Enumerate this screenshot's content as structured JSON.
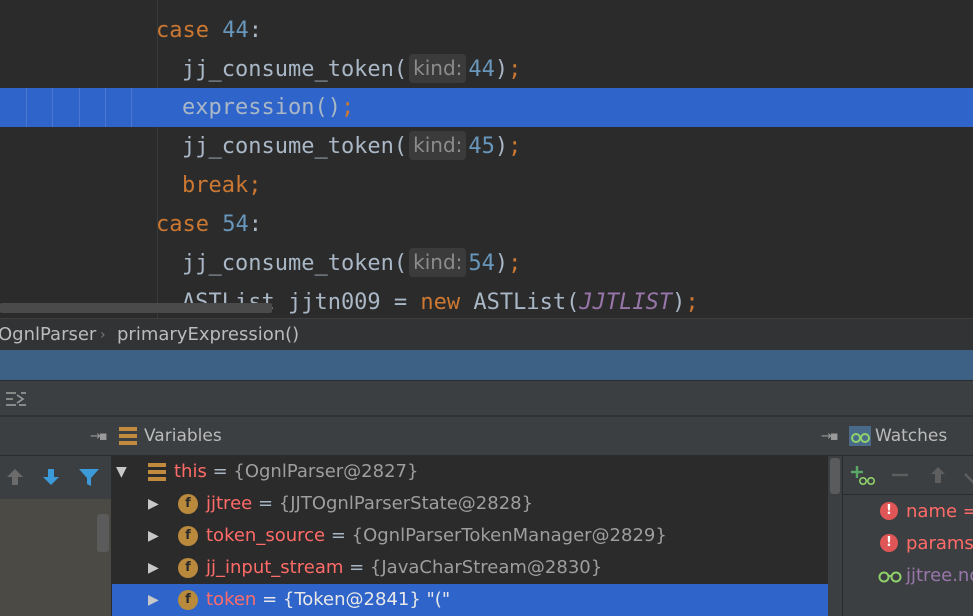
{
  "editor": {
    "lines": [
      {
        "indent": "case",
        "parts": [
          {
            "t": "case ",
            "c": "kw"
          },
          {
            "t": "44",
            "c": "num"
          },
          {
            "t": ":",
            "c": "id"
          }
        ]
      },
      {
        "indent": "body",
        "parts": [
          {
            "t": "jj_consume_token(",
            "c": "id"
          },
          {
            "t": "kind:",
            "c": "hint"
          },
          {
            "t": "44",
            "c": "num"
          },
          {
            "t": ")",
            "c": "id"
          },
          {
            "t": ";",
            "c": "kw"
          }
        ]
      },
      {
        "indent": "body",
        "exec": true,
        "parts": [
          {
            "t": "expression()",
            "c": "id"
          },
          {
            "t": ";",
            "c": "kw"
          }
        ]
      },
      {
        "indent": "body",
        "parts": [
          {
            "t": "jj_consume_token(",
            "c": "id"
          },
          {
            "t": "kind:",
            "c": "hint"
          },
          {
            "t": "45",
            "c": "num"
          },
          {
            "t": ")",
            "c": "id"
          },
          {
            "t": ";",
            "c": "kw"
          }
        ]
      },
      {
        "indent": "body",
        "parts": [
          {
            "t": "break",
            "c": "kw"
          },
          {
            "t": ";",
            "c": "kw"
          }
        ]
      },
      {
        "indent": "case",
        "parts": [
          {
            "t": "case ",
            "c": "kw"
          },
          {
            "t": "54",
            "c": "num"
          },
          {
            "t": ":",
            "c": "id"
          }
        ]
      },
      {
        "indent": "body",
        "parts": [
          {
            "t": "jj_consume_token(",
            "c": "id"
          },
          {
            "t": "kind:",
            "c": "hint"
          },
          {
            "t": "54",
            "c": "num"
          },
          {
            "t": ")",
            "c": "id"
          },
          {
            "t": ";",
            "c": "kw"
          }
        ]
      },
      {
        "indent": "body",
        "parts": [
          {
            "t": "ASTList jjtn009 = ",
            "c": "id"
          },
          {
            "t": "new ",
            "c": "kw"
          },
          {
            "t": "ASTList(",
            "c": "id"
          },
          {
            "t": "JJTLIST",
            "c": "const"
          },
          {
            "t": ")",
            "c": "id"
          },
          {
            "t": ";",
            "c": "kw"
          }
        ]
      }
    ]
  },
  "breadcrumb": {
    "items": [
      "OgnlParser",
      "primaryExpression()"
    ],
    "separator": "›"
  },
  "panels": {
    "variables_label": "Variables",
    "watches_label": "Watches"
  },
  "variables": {
    "rows": [
      {
        "level": 0,
        "expanded": true,
        "icon": "object-icon",
        "name": "this",
        "eq": " = ",
        "value": "{OgnlParser@2827}",
        "selected": false
      },
      {
        "level": 1,
        "expanded": false,
        "icon": "field-icon",
        "name": "jjtree",
        "eq": " = ",
        "value": "{JJTOgnlParserState@2828}",
        "selected": false
      },
      {
        "level": 1,
        "expanded": false,
        "icon": "field-icon",
        "name": "token_source",
        "eq": " = ",
        "value": "{OgnlParserTokenManager@2829}",
        "selected": false
      },
      {
        "level": 1,
        "expanded": false,
        "icon": "field-icon",
        "name": "jj_input_stream",
        "eq": " = ",
        "value": "{JavaCharStream@2830}",
        "selected": false
      },
      {
        "level": 1,
        "expanded": false,
        "icon": "field-icon",
        "name": "token",
        "eq": " = ",
        "value": "{Token@2841} \"(\"",
        "selected": true
      }
    ],
    "field_icon_letter": "f"
  },
  "watches": {
    "rows": [
      {
        "icon": "error-icon",
        "name": "name ="
      },
      {
        "icon": "error-icon",
        "name": "params"
      },
      {
        "icon": "glasses-icon",
        "name": "jjtree.no"
      }
    ]
  },
  "colors": {
    "exec_line": "#2f65ca",
    "frame_bar": "#3d6185",
    "keyword": "#cc7832",
    "number": "#6897bb",
    "var_name": "#ff6b68"
  }
}
